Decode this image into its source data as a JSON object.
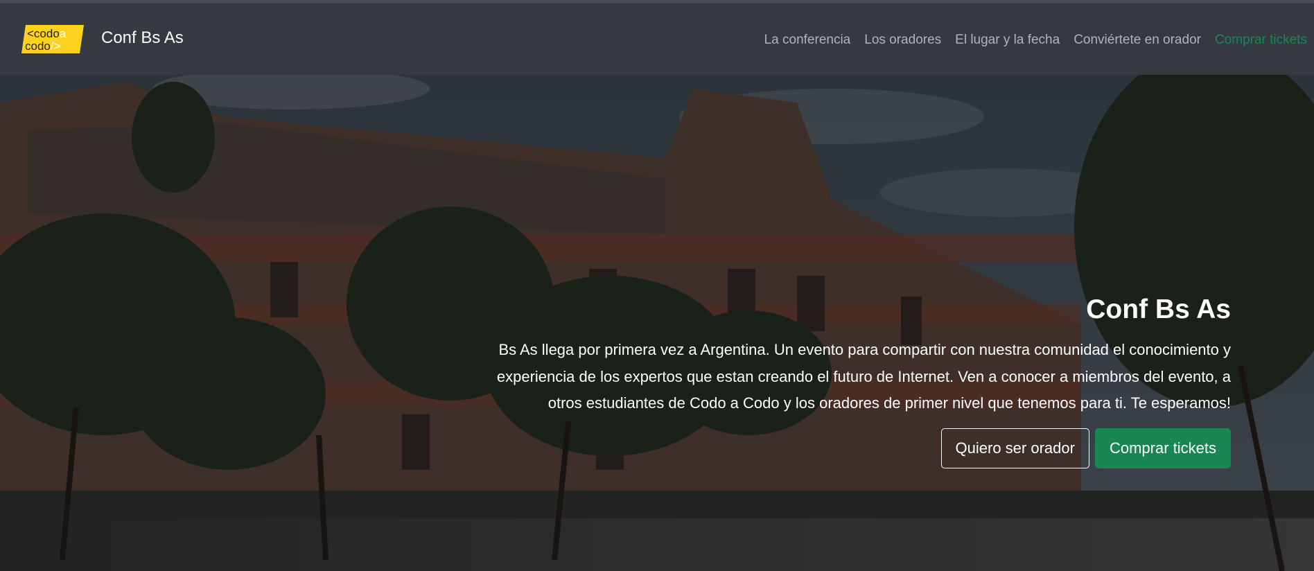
{
  "navbar": {
    "logo": {
      "line1": "<codo",
      "line1_accent": "a",
      "line2": "codo",
      "line2_accent": "/>"
    },
    "brand": "Conf Bs As",
    "links": [
      {
        "label": "La conferencia"
      },
      {
        "label": "Los oradores"
      },
      {
        "label": "El lugar y la fecha"
      },
      {
        "label": "Conviértete en orador"
      },
      {
        "label": "Comprar tickets"
      }
    ]
  },
  "hero": {
    "title": "Conf Bs As",
    "description": "Bs As llega por primera vez a Argentina. Un evento para compartir con nuestra comunidad el conocimiento y experiencia de los expertos que estan creando el futuro de Internet. Ven a conocer a miembros del evento, a otros estudiantes de Codo a Codo y los oradores de primer nivel que tenemos para ti. Te esperamos!",
    "buttons": {
      "speaker": "Quiero ser orador",
      "tickets": "Comprar tickets"
    }
  },
  "colors": {
    "navbar_bg": "#343a40",
    "brand_yellow": "#ffd21f",
    "success": "#198754",
    "nav_link": "#aeb4bb"
  }
}
